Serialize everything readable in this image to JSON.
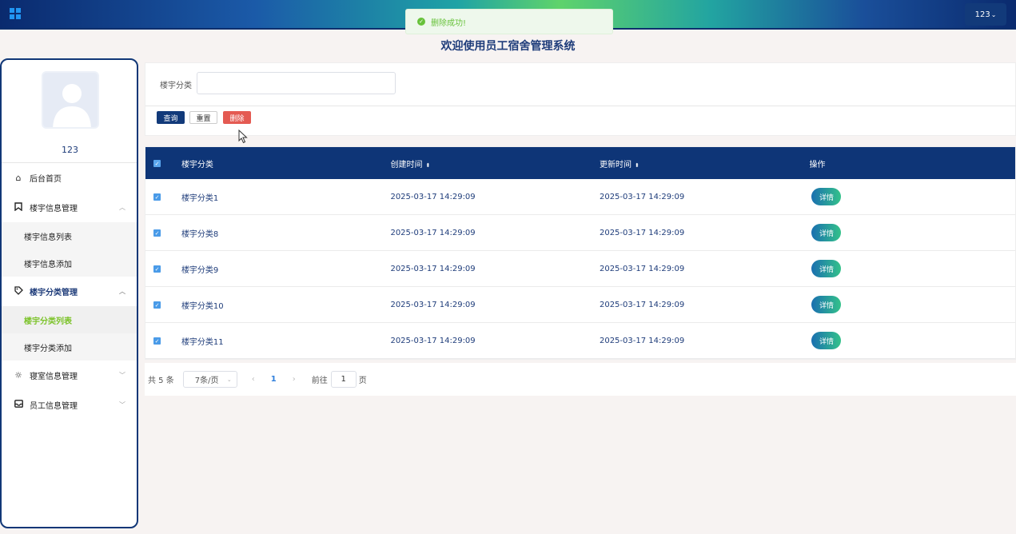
{
  "header": {
    "user_label": "123",
    "colors": {
      "accent": "#0e3577",
      "brand_gradient": [
        "#0a2a6e",
        "#5fd36b"
      ]
    }
  },
  "toast": {
    "message": "删除成功!",
    "icon": "check-circle-icon",
    "color": "#67c23a"
  },
  "page_title": "欢迎使用员工宿舍管理系统",
  "sidebar": {
    "username": "123",
    "items": [
      {
        "label": "后台首页",
        "icon": "home-icon"
      },
      {
        "label": "楼宇信息管理",
        "icon": "bookmark-icon",
        "expanded": true,
        "children": [
          "楼宇信息列表",
          "楼宇信息添加"
        ]
      },
      {
        "label": "楼宇分类管理",
        "icon": "tag-icon",
        "expanded": true,
        "children": [
          "楼宇分类列表",
          "楼宇分类添加"
        ],
        "active_child": "楼宇分类列表"
      },
      {
        "label": "寝室信息管理",
        "icon": "sun-icon",
        "expanded": false
      },
      {
        "label": "员工信息管理",
        "icon": "inbox-icon",
        "expanded": false
      }
    ]
  },
  "search": {
    "field_label": "楼宇分类",
    "field_value": "",
    "query_label": "查询",
    "reset_label": "重置",
    "delete_label": "删除"
  },
  "table": {
    "columns": [
      "楼宇分类",
      "创建时间",
      "更新时间",
      "操作"
    ],
    "rows": [
      {
        "name": "楼宇分类1",
        "created": "2025-03-17 14:29:09",
        "updated": "2025-03-17 14:29:09",
        "action": "详情",
        "checked": true
      },
      {
        "name": "楼宇分类8",
        "created": "2025-03-17 14:29:09",
        "updated": "2025-03-17 14:29:09",
        "action": "详情",
        "checked": true
      },
      {
        "name": "楼宇分类9",
        "created": "2025-03-17 14:29:09",
        "updated": "2025-03-17 14:29:09",
        "action": "详情",
        "checked": true
      },
      {
        "name": "楼宇分类10",
        "created": "2025-03-17 14:29:09",
        "updated": "2025-03-17 14:29:09",
        "action": "详情",
        "checked": true
      },
      {
        "name": "楼宇分类11",
        "created": "2025-03-17 14:29:09",
        "updated": "2025-03-17 14:29:09",
        "action": "详情",
        "checked": true
      }
    ]
  },
  "pagination": {
    "total": "共 5 条",
    "page_size": "7条/页",
    "current_page": "1",
    "goto_label": "前往",
    "goto_value": "1",
    "page_suffix": "页"
  }
}
